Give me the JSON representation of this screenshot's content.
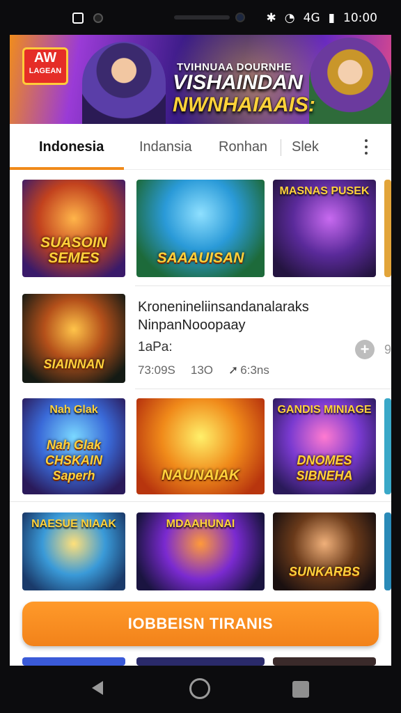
{
  "status_bar": {
    "time": "10:00",
    "network": "4G",
    "icons": [
      "app-icon",
      "camera-icon",
      "bluetooth-icon",
      "wifi-icon",
      "battery-icon"
    ]
  },
  "banner": {
    "logo_top": "AW",
    "logo_bottom": "LAGEAN",
    "line1": "TVIHNUAA DOURNHE",
    "line2": "VISHAINDAN",
    "line3": "NWNHAIAAIS:"
  },
  "tabs": [
    {
      "label": "Indonesia",
      "active": true
    },
    {
      "label": "Indansia",
      "active": false
    },
    {
      "label": "Ronhan",
      "active": false
    },
    {
      "label": "Slek",
      "active": false
    }
  ],
  "tiles": {
    "row1": [
      "SUASOIN SEMES",
      "SAAAUISAN",
      "MASNAS PUSEK",
      ""
    ],
    "featured": "SIAINNAN",
    "row2": [
      "Nah Glak CHSKAIN Saperh",
      "NAUNAIAK",
      "DNOMES SIBNEHA",
      ""
    ],
    "row3": [
      "NAESUE NIAAK",
      "MDAAHUNAI",
      "SUNKARBS",
      ""
    ],
    "row2_tops": [
      "Nah  Glak",
      "",
      "GANDIS MINIAGE",
      ""
    ]
  },
  "featured_details": {
    "title": "Kronenineliinsandanalaraks",
    "subtitle": "NinpanNooopaay",
    "label": "1aPa:",
    "stat1": "73:09S",
    "stat2": "13O",
    "stat3": "6:3ns"
  },
  "cta": {
    "label": "IOBBEISN TIRANIS"
  },
  "colors": {
    "accent": "#f08a1a",
    "cta": "#f2821a",
    "banner_purple": "#3a1b86"
  }
}
